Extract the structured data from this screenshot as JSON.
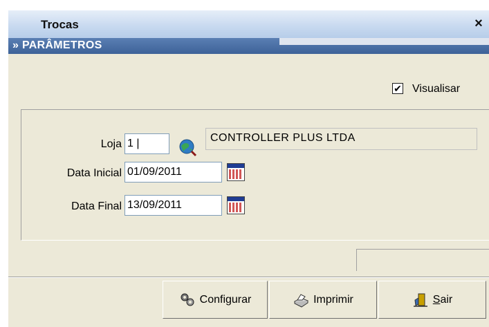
{
  "window": {
    "title": "Trocas",
    "close_glyph": "×"
  },
  "section": {
    "title": "» PARÂMETROS"
  },
  "visualizar": {
    "label": "Visualisar",
    "checked": true,
    "check_glyph": "✔"
  },
  "form": {
    "loja": {
      "label": "Loja",
      "value": "1 |",
      "description": "CONTROLLER PLUS LTDA"
    },
    "data_inicial": {
      "label": "Data Inicial",
      "value": "01/09/2011"
    },
    "data_final": {
      "label": "Data Final",
      "value": "13/09/2011"
    }
  },
  "buttons": {
    "configurar": {
      "label": "Configurar",
      "icon": "gears-icon"
    },
    "imprimir": {
      "label": "Imprimir",
      "icon": "printer-icon"
    },
    "sair": {
      "label_rest": "air",
      "label_underlined": "S",
      "icon": "exit-door-icon"
    }
  },
  "colors": {
    "section_bar": "#3d6298",
    "window_bg": "#ece9d8",
    "titlebar": "#c9daf0"
  }
}
